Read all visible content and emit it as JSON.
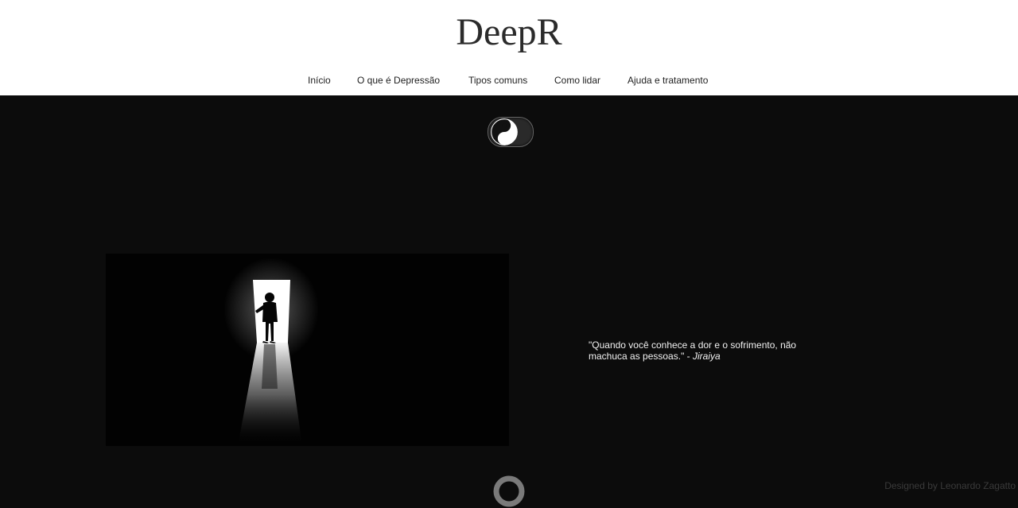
{
  "header": {
    "logo": "DeepR",
    "nav": [
      {
        "label": "Início"
      },
      {
        "label": "O que é Depressão"
      },
      {
        "label": "Tipos comuns"
      },
      {
        "label": "Como lidar"
      },
      {
        "label": "Ajuda e tratamento"
      }
    ]
  },
  "theme_toggle": {
    "icon": "yin-yang-icon",
    "state": "dark"
  },
  "hero": {
    "image": "silhouette-in-doorway-image",
    "quote_text": "\"Quando você conhece a dor e o sofrimento, não machuca as pessoas.\" - ",
    "quote_author": "Jiraiya"
  },
  "loader": {
    "icon": "loading-spinner-icon"
  },
  "footer": {
    "credit": "Designed by Leonardo Zagatto"
  },
  "colors": {
    "header_bg": "#ffffff",
    "page_bg": "#0c0c0c",
    "text_light": "#f2f2f2",
    "logo_text": "#2b2b2b"
  }
}
